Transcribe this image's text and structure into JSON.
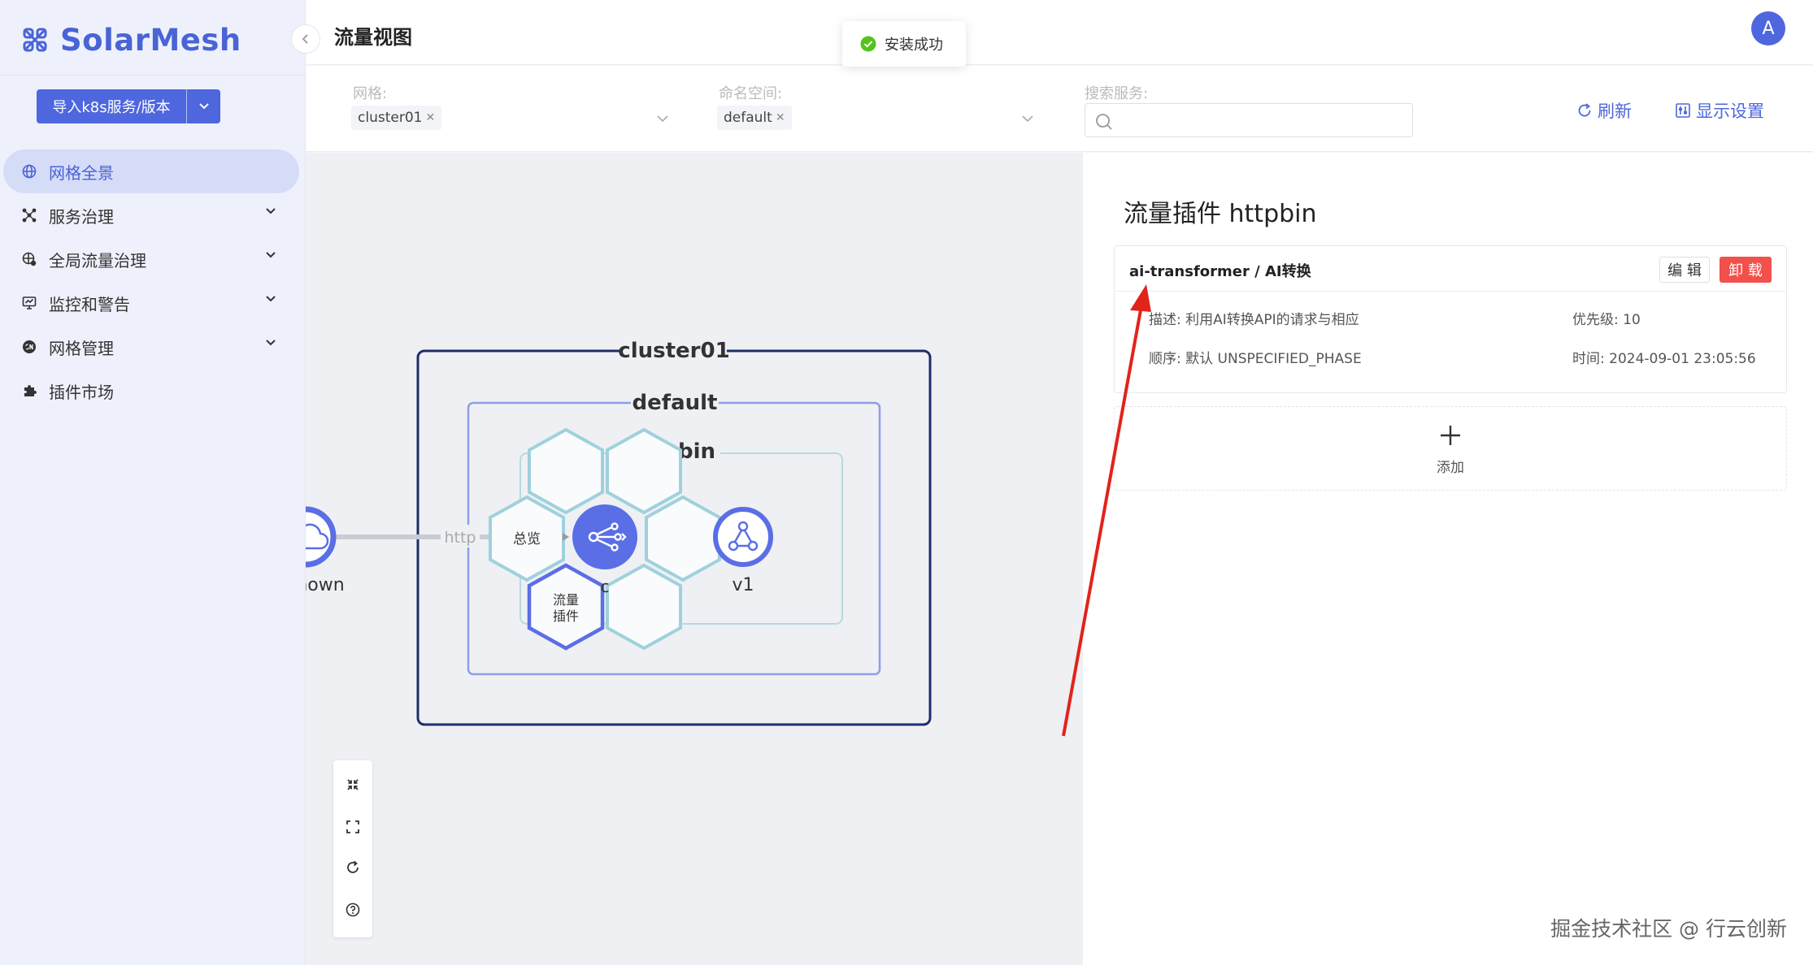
{
  "app": {
    "name": "SolarMesh"
  },
  "sidebar": {
    "import_button": "导入k8s服务/版本",
    "items": [
      {
        "label": "网格全景",
        "icon": "globe-icon",
        "active": true,
        "expandable": false
      },
      {
        "label": "服务治理",
        "icon": "cluster-icon",
        "active": false,
        "expandable": true
      },
      {
        "label": "全局流量治理",
        "icon": "traffic-icon",
        "active": false,
        "expandable": true
      },
      {
        "label": "监控和警告",
        "icon": "monitor-icon",
        "active": false,
        "expandable": true
      },
      {
        "label": "网格管理",
        "icon": "mesh-manage-icon",
        "active": false,
        "expandable": true
      },
      {
        "label": "插件市场",
        "icon": "puzzle-icon",
        "active": false,
        "expandable": false
      }
    ]
  },
  "header": {
    "title": "流量视图",
    "avatar_letter": "A"
  },
  "toast": {
    "text": "安装成功"
  },
  "filters": {
    "mesh": {
      "label": "网格:",
      "value": "cluster01"
    },
    "namespace": {
      "label": "命名空间:",
      "value": "default"
    },
    "search": {
      "label": "搜索服务:",
      "placeholder": ""
    },
    "refresh_label": "刷新",
    "display_settings_label": "显示设置"
  },
  "graph": {
    "cluster_label": "cluster01",
    "namespace_label": "default",
    "service_label": "bin",
    "edge_label": "http",
    "source_label": "nown",
    "version_label": "v1",
    "hex_overview": "总览",
    "hex_plugin_line1": "流量",
    "hex_plugin_line2": "插件",
    "hidden_char": "c",
    "colors": {
      "cluster_border": "#1e2d6b",
      "namespace_border": "#8e9ee6",
      "service_border": "#a7d3d9",
      "node": "#5a6ee6",
      "hex": "#9fd1dc"
    }
  },
  "panel": {
    "title": "流量插件 httpbin",
    "plugin": {
      "name": "ai-transformer / AI转换",
      "edit_label": "编 辑",
      "uninstall_label": "卸 载",
      "description": "描述: 利用AI转换API的请求与相应",
      "priority": "优先级: 10",
      "order": "顺序: 默认 UNSPECIFIED_PHASE",
      "time": "时间: 2024-09-01 23:05:56"
    },
    "add_label": "添加"
  },
  "watermark": "掘金技术社区 @ 行云创新"
}
